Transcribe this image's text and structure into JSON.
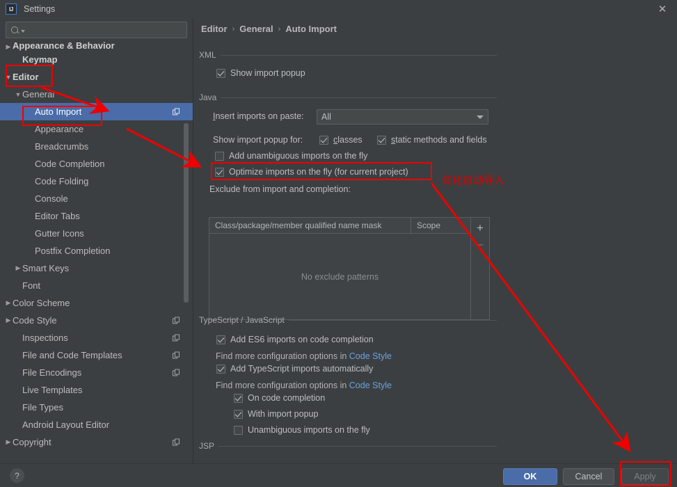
{
  "window": {
    "title": "Settings",
    "logo_text": "IJ",
    "close_icon": "close-icon"
  },
  "sidebar": {
    "search": {
      "value": "",
      "placeholder": ""
    },
    "items": [
      {
        "label": "Appearance & Behavior",
        "arrow": "▶",
        "indent": 0,
        "bold": true,
        "clipped": true,
        "copy": false,
        "selected": false
      },
      {
        "label": "Keymap",
        "arrow": "",
        "indent": 1,
        "bold": true,
        "clipped": false,
        "copy": false,
        "selected": false
      },
      {
        "label": "Editor",
        "arrow": "▼",
        "indent": 0,
        "bold": true,
        "clipped": false,
        "copy": false,
        "selected": false
      },
      {
        "label": "General",
        "arrow": "▼",
        "indent": 1,
        "bold": false,
        "clipped": false,
        "copy": false,
        "selected": false
      },
      {
        "label": "Auto Import",
        "arrow": "",
        "indent": 2,
        "bold": false,
        "clipped": false,
        "copy": true,
        "selected": true
      },
      {
        "label": "Appearance",
        "arrow": "",
        "indent": 2,
        "bold": false,
        "clipped": false,
        "copy": false,
        "selected": false
      },
      {
        "label": "Breadcrumbs",
        "arrow": "",
        "indent": 2,
        "bold": false,
        "clipped": false,
        "copy": false,
        "selected": false
      },
      {
        "label": "Code Completion",
        "arrow": "",
        "indent": 2,
        "bold": false,
        "clipped": false,
        "copy": false,
        "selected": false
      },
      {
        "label": "Code Folding",
        "arrow": "",
        "indent": 2,
        "bold": false,
        "clipped": false,
        "copy": false,
        "selected": false
      },
      {
        "label": "Console",
        "arrow": "",
        "indent": 2,
        "bold": false,
        "clipped": false,
        "copy": false,
        "selected": false
      },
      {
        "label": "Editor Tabs",
        "arrow": "",
        "indent": 2,
        "bold": false,
        "clipped": false,
        "copy": false,
        "selected": false
      },
      {
        "label": "Gutter Icons",
        "arrow": "",
        "indent": 2,
        "bold": false,
        "clipped": false,
        "copy": false,
        "selected": false
      },
      {
        "label": "Postfix Completion",
        "arrow": "",
        "indent": 2,
        "bold": false,
        "clipped": false,
        "copy": false,
        "selected": false
      },
      {
        "label": "Smart Keys",
        "arrow": "▶",
        "indent": 1,
        "bold": false,
        "clipped": false,
        "copy": false,
        "selected": false
      },
      {
        "label": "Font",
        "arrow": "",
        "indent": 1,
        "bold": false,
        "clipped": false,
        "copy": false,
        "selected": false
      },
      {
        "label": "Color Scheme",
        "arrow": "▶",
        "indent": 0,
        "bold": false,
        "clipped": false,
        "copy": false,
        "selected": false
      },
      {
        "label": "Code Style",
        "arrow": "▶",
        "indent": 0,
        "bold": false,
        "clipped": false,
        "copy": true,
        "selected": false
      },
      {
        "label": "Inspections",
        "arrow": "",
        "indent": 1,
        "bold": false,
        "clipped": false,
        "copy": true,
        "selected": false
      },
      {
        "label": "File and Code Templates",
        "arrow": "",
        "indent": 1,
        "bold": false,
        "clipped": false,
        "copy": true,
        "selected": false
      },
      {
        "label": "File Encodings",
        "arrow": "",
        "indent": 1,
        "bold": false,
        "clipped": false,
        "copy": true,
        "selected": false
      },
      {
        "label": "Live Templates",
        "arrow": "",
        "indent": 1,
        "bold": false,
        "clipped": false,
        "copy": false,
        "selected": false
      },
      {
        "label": "File Types",
        "arrow": "",
        "indent": 1,
        "bold": false,
        "clipped": false,
        "copy": false,
        "selected": false
      },
      {
        "label": "Android Layout Editor",
        "arrow": "",
        "indent": 1,
        "bold": false,
        "clipped": false,
        "copy": false,
        "selected": false
      },
      {
        "label": "Copyright",
        "arrow": "▶",
        "indent": 0,
        "bold": false,
        "clipped": false,
        "copy": true,
        "selected": false
      }
    ]
  },
  "breadcrumb": {
    "part1": "Editor",
    "part2": "General",
    "part3": "Auto Import",
    "separator": "›"
  },
  "sections": {
    "xml": {
      "title": "XML",
      "show_import_popup": {
        "label": "Show import popup",
        "checked": true
      }
    },
    "java": {
      "title": "Java",
      "insert_imports_label": "Insert imports on paste:",
      "insert_imports_mnemonic": "I",
      "insert_imports_rest": "nsert imports on paste:",
      "insert_imports_value": "All",
      "show_popup_for_label": "Show import popup for:",
      "classes": {
        "label": "classes",
        "mnemonic": "c",
        "rest": "lasses",
        "checked": true
      },
      "static_methods": {
        "label": "static methods and fields",
        "mnemonic": "s",
        "rest": "tatic methods and fields",
        "checked": true
      },
      "add_unambiguous": {
        "label": "Add unambiguous imports on the fly",
        "checked": false
      },
      "optimize": {
        "label": "Optimize imports on the fly (for current project)",
        "checked": true
      },
      "exclude_label": "Exclude from import and completion:",
      "table": {
        "col1": "Class/package/member qualified name mask",
        "col2": "Scope",
        "empty_text": "No exclude patterns",
        "add_button": "+",
        "remove_button": "–",
        "rows": []
      }
    },
    "ts_js": {
      "title": "TypeScript / JavaScript",
      "add_es6": {
        "label": "Add ES6 imports on code completion",
        "checked": true
      },
      "hint1_prefix": "Find more configuration options in ",
      "hint1_link": "Code Style",
      "add_ts": {
        "label": "Add TypeScript imports automatically",
        "checked": true
      },
      "hint2_prefix": "Find more configuration options in ",
      "hint2_link": "Code Style",
      "on_code_completion": {
        "label": "On code completion",
        "checked": true
      },
      "with_import_popup": {
        "label": "With import popup",
        "checked": true
      },
      "unambiguous_on_fly": {
        "label": "Unambiguous imports on the fly",
        "checked": false
      }
    },
    "jsp": {
      "title": "JSP"
    }
  },
  "footer": {
    "help_label": "?",
    "ok_label": "OK",
    "cancel_label": "Cancel",
    "apply_label": "Apply"
  },
  "annotations": {
    "note_cn": "优化自动导入",
    "accent_color": "#ee0000"
  },
  "colors": {
    "background": "#3c3f41",
    "selection": "#4a6ca8",
    "link": "#6aa3e0",
    "text": "#bbbbbb",
    "annotation": "#ee0000"
  }
}
